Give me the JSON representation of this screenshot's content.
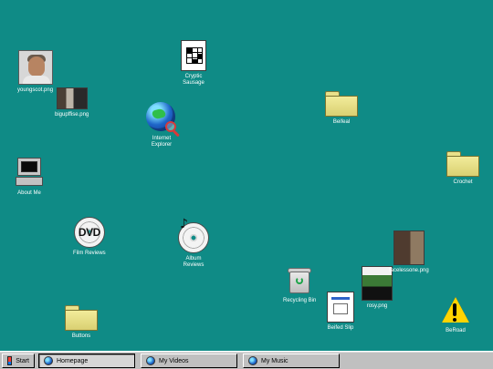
{
  "desktop": {
    "background_color": "#0f8b86",
    "icons": {
      "youngscot": {
        "label": "youngscot.png",
        "icon": "person-photo-icon"
      },
      "bigupffise": {
        "label": "bigupffise.png",
        "icon": "photo-thumbnail-icon"
      },
      "cryptic_sausage": {
        "label": "Cryptic\nSausage",
        "icon": "crossword-document-icon"
      },
      "internet_explorer": {
        "label": "Internet\nExplorer",
        "icon": "internet-explorer-globe-icon"
      },
      "about_me": {
        "label": "About Me",
        "icon": "computer-icon"
      },
      "film_reviews": {
        "label": "Film Reviews",
        "icon": "dvd-icon"
      },
      "album_reviews": {
        "label": "Album\nReviews",
        "icon": "music-disc-icon"
      },
      "buttons": {
        "label": "Buttons",
        "icon": "folder-icon"
      },
      "beifeal": {
        "label": "Beifeal",
        "icon": "folder-icon"
      },
      "crochet": {
        "label": "Crochet",
        "icon": "folder-icon"
      },
      "recycling_bin": {
        "label": "Recycling Bin",
        "icon": "recycle-bin-icon"
      },
      "beifed_slip": {
        "label": "Beifed Slip",
        "icon": "document-icon"
      },
      "rosy": {
        "label": "rosy.png",
        "icon": "photo-thumbnail-icon"
      },
      "facelessone": {
        "label": "facelessone.png",
        "icon": "photo-thumbnail-icon"
      },
      "beroad": {
        "label": "BeRoad",
        "icon": "warning-icon"
      }
    }
  },
  "taskbar": {
    "start_label": "Start",
    "items": [
      {
        "label": "Homepage",
        "icon": "ie-globe-icon",
        "pressed": true
      },
      {
        "label": "My Videos",
        "icon": "ie-globe-icon",
        "pressed": false
      },
      {
        "label": "My Music",
        "icon": "ie-globe-icon",
        "pressed": false
      }
    ]
  }
}
